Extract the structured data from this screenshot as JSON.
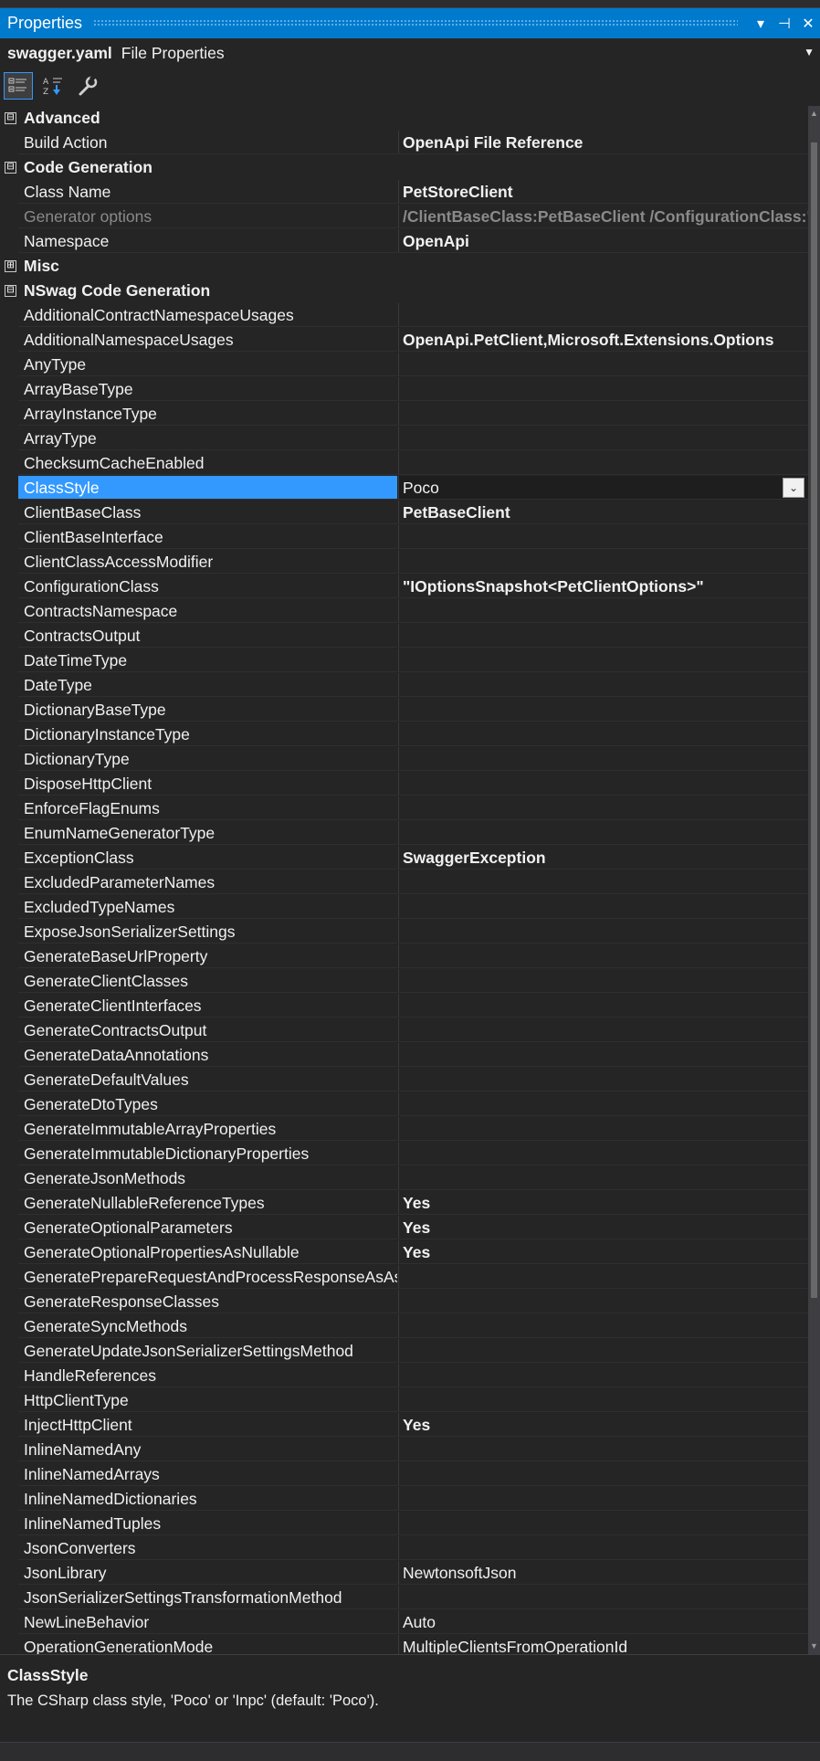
{
  "window": {
    "title": "Properties",
    "dropdown_icon": "▾",
    "pin_icon": "⊣",
    "close_icon": "✕"
  },
  "object": {
    "name": "swagger.yaml",
    "type": "File Properties"
  },
  "grid": {
    "rows": [
      {
        "kind": "cat",
        "toggle": "⊟",
        "label": "Advanced"
      },
      {
        "kind": "prop",
        "name": "Build Action",
        "value": "OpenApi File Reference",
        "bold": true
      },
      {
        "kind": "cat",
        "toggle": "⊟",
        "label": "Code Generation"
      },
      {
        "kind": "prop",
        "name": "Class Name",
        "value": "PetStoreClient",
        "bold": true
      },
      {
        "kind": "prop",
        "name": "Generator options",
        "value": " /ClientBaseClass:PetBaseClient /ConfigurationClass:\"",
        "bold": true,
        "disabled": true
      },
      {
        "kind": "prop",
        "name": "Namespace",
        "value": "OpenApi",
        "bold": true
      },
      {
        "kind": "cat",
        "toggle": "⊞",
        "label": "Misc"
      },
      {
        "kind": "cat",
        "toggle": "⊟",
        "label": "NSwag Code Generation"
      },
      {
        "kind": "prop",
        "name": "AdditionalContractNamespaceUsages",
        "value": ""
      },
      {
        "kind": "prop",
        "name": "AdditionalNamespaceUsages",
        "value": "OpenApi.PetClient,Microsoft.Extensions.Options",
        "bold": true
      },
      {
        "kind": "prop",
        "name": "AnyType",
        "value": ""
      },
      {
        "kind": "prop",
        "name": "ArrayBaseType",
        "value": ""
      },
      {
        "kind": "prop",
        "name": "ArrayInstanceType",
        "value": ""
      },
      {
        "kind": "prop",
        "name": "ArrayType",
        "value": ""
      },
      {
        "kind": "prop",
        "name": "ChecksumCacheEnabled",
        "value": ""
      },
      {
        "kind": "prop",
        "name": "ClassStyle",
        "value": "Poco",
        "selected": true,
        "dropdown": true
      },
      {
        "kind": "prop",
        "name": "ClientBaseClass",
        "value": "PetBaseClient",
        "bold": true
      },
      {
        "kind": "prop",
        "name": "ClientBaseInterface",
        "value": ""
      },
      {
        "kind": "prop",
        "name": "ClientClassAccessModifier",
        "value": ""
      },
      {
        "kind": "prop",
        "name": "ConfigurationClass",
        "value": "\"IOptionsSnapshot<PetClientOptions>\"",
        "bold": true
      },
      {
        "kind": "prop",
        "name": "ContractsNamespace",
        "value": ""
      },
      {
        "kind": "prop",
        "name": "ContractsOutput",
        "value": ""
      },
      {
        "kind": "prop",
        "name": "DateTimeType",
        "value": ""
      },
      {
        "kind": "prop",
        "name": "DateType",
        "value": ""
      },
      {
        "kind": "prop",
        "name": "DictionaryBaseType",
        "value": ""
      },
      {
        "kind": "prop",
        "name": "DictionaryInstanceType",
        "value": ""
      },
      {
        "kind": "prop",
        "name": "DictionaryType",
        "value": ""
      },
      {
        "kind": "prop",
        "name": "DisposeHttpClient",
        "value": ""
      },
      {
        "kind": "prop",
        "name": "EnforceFlagEnums",
        "value": ""
      },
      {
        "kind": "prop",
        "name": "EnumNameGeneratorType",
        "value": ""
      },
      {
        "kind": "prop",
        "name": "ExceptionClass",
        "value": "SwaggerException",
        "bold": true
      },
      {
        "kind": "prop",
        "name": "ExcludedParameterNames",
        "value": ""
      },
      {
        "kind": "prop",
        "name": "ExcludedTypeNames",
        "value": ""
      },
      {
        "kind": "prop",
        "name": "ExposeJsonSerializerSettings",
        "value": ""
      },
      {
        "kind": "prop",
        "name": "GenerateBaseUrlProperty",
        "value": ""
      },
      {
        "kind": "prop",
        "name": "GenerateClientClasses",
        "value": ""
      },
      {
        "kind": "prop",
        "name": "GenerateClientInterfaces",
        "value": ""
      },
      {
        "kind": "prop",
        "name": "GenerateContractsOutput",
        "value": ""
      },
      {
        "kind": "prop",
        "name": "GenerateDataAnnotations",
        "value": ""
      },
      {
        "kind": "prop",
        "name": "GenerateDefaultValues",
        "value": ""
      },
      {
        "kind": "prop",
        "name": "GenerateDtoTypes",
        "value": ""
      },
      {
        "kind": "prop",
        "name": "GenerateImmutableArrayProperties",
        "value": ""
      },
      {
        "kind": "prop",
        "name": "GenerateImmutableDictionaryProperties",
        "value": ""
      },
      {
        "kind": "prop",
        "name": "GenerateJsonMethods",
        "value": ""
      },
      {
        "kind": "prop",
        "name": "GenerateNullableReferenceTypes",
        "value": "Yes",
        "bold": true
      },
      {
        "kind": "prop",
        "name": "GenerateOptionalParameters",
        "value": "Yes",
        "bold": true
      },
      {
        "kind": "prop",
        "name": "GenerateOptionalPropertiesAsNullable",
        "value": "Yes",
        "bold": true
      },
      {
        "kind": "prop",
        "name": "GeneratePrepareRequestAndProcessResponseAsAsy",
        "value": ""
      },
      {
        "kind": "prop",
        "name": "GenerateResponseClasses",
        "value": ""
      },
      {
        "kind": "prop",
        "name": "GenerateSyncMethods",
        "value": ""
      },
      {
        "kind": "prop",
        "name": "GenerateUpdateJsonSerializerSettingsMethod",
        "value": ""
      },
      {
        "kind": "prop",
        "name": "HandleReferences",
        "value": ""
      },
      {
        "kind": "prop",
        "name": "HttpClientType",
        "value": ""
      },
      {
        "kind": "prop",
        "name": "InjectHttpClient",
        "value": "Yes",
        "bold": true
      },
      {
        "kind": "prop",
        "name": "InlineNamedAny",
        "value": ""
      },
      {
        "kind": "prop",
        "name": "InlineNamedArrays",
        "value": ""
      },
      {
        "kind": "prop",
        "name": "InlineNamedDictionaries",
        "value": ""
      },
      {
        "kind": "prop",
        "name": "InlineNamedTuples",
        "value": ""
      },
      {
        "kind": "prop",
        "name": "JsonConverters",
        "value": ""
      },
      {
        "kind": "prop",
        "name": "JsonLibrary",
        "value": "NewtonsoftJson"
      },
      {
        "kind": "prop",
        "name": "JsonSerializerSettingsTransformationMethod",
        "value": ""
      },
      {
        "kind": "prop",
        "name": "NewLineBehavior",
        "value": "Auto"
      },
      {
        "kind": "prop",
        "name": "OperationGenerationMode",
        "value": "MultipleClientsFromOperationId"
      }
    ]
  },
  "description": {
    "title": "ClassStyle",
    "text": "The CSharp class style, 'Poco' or 'Inpc' (default: 'Poco')."
  }
}
